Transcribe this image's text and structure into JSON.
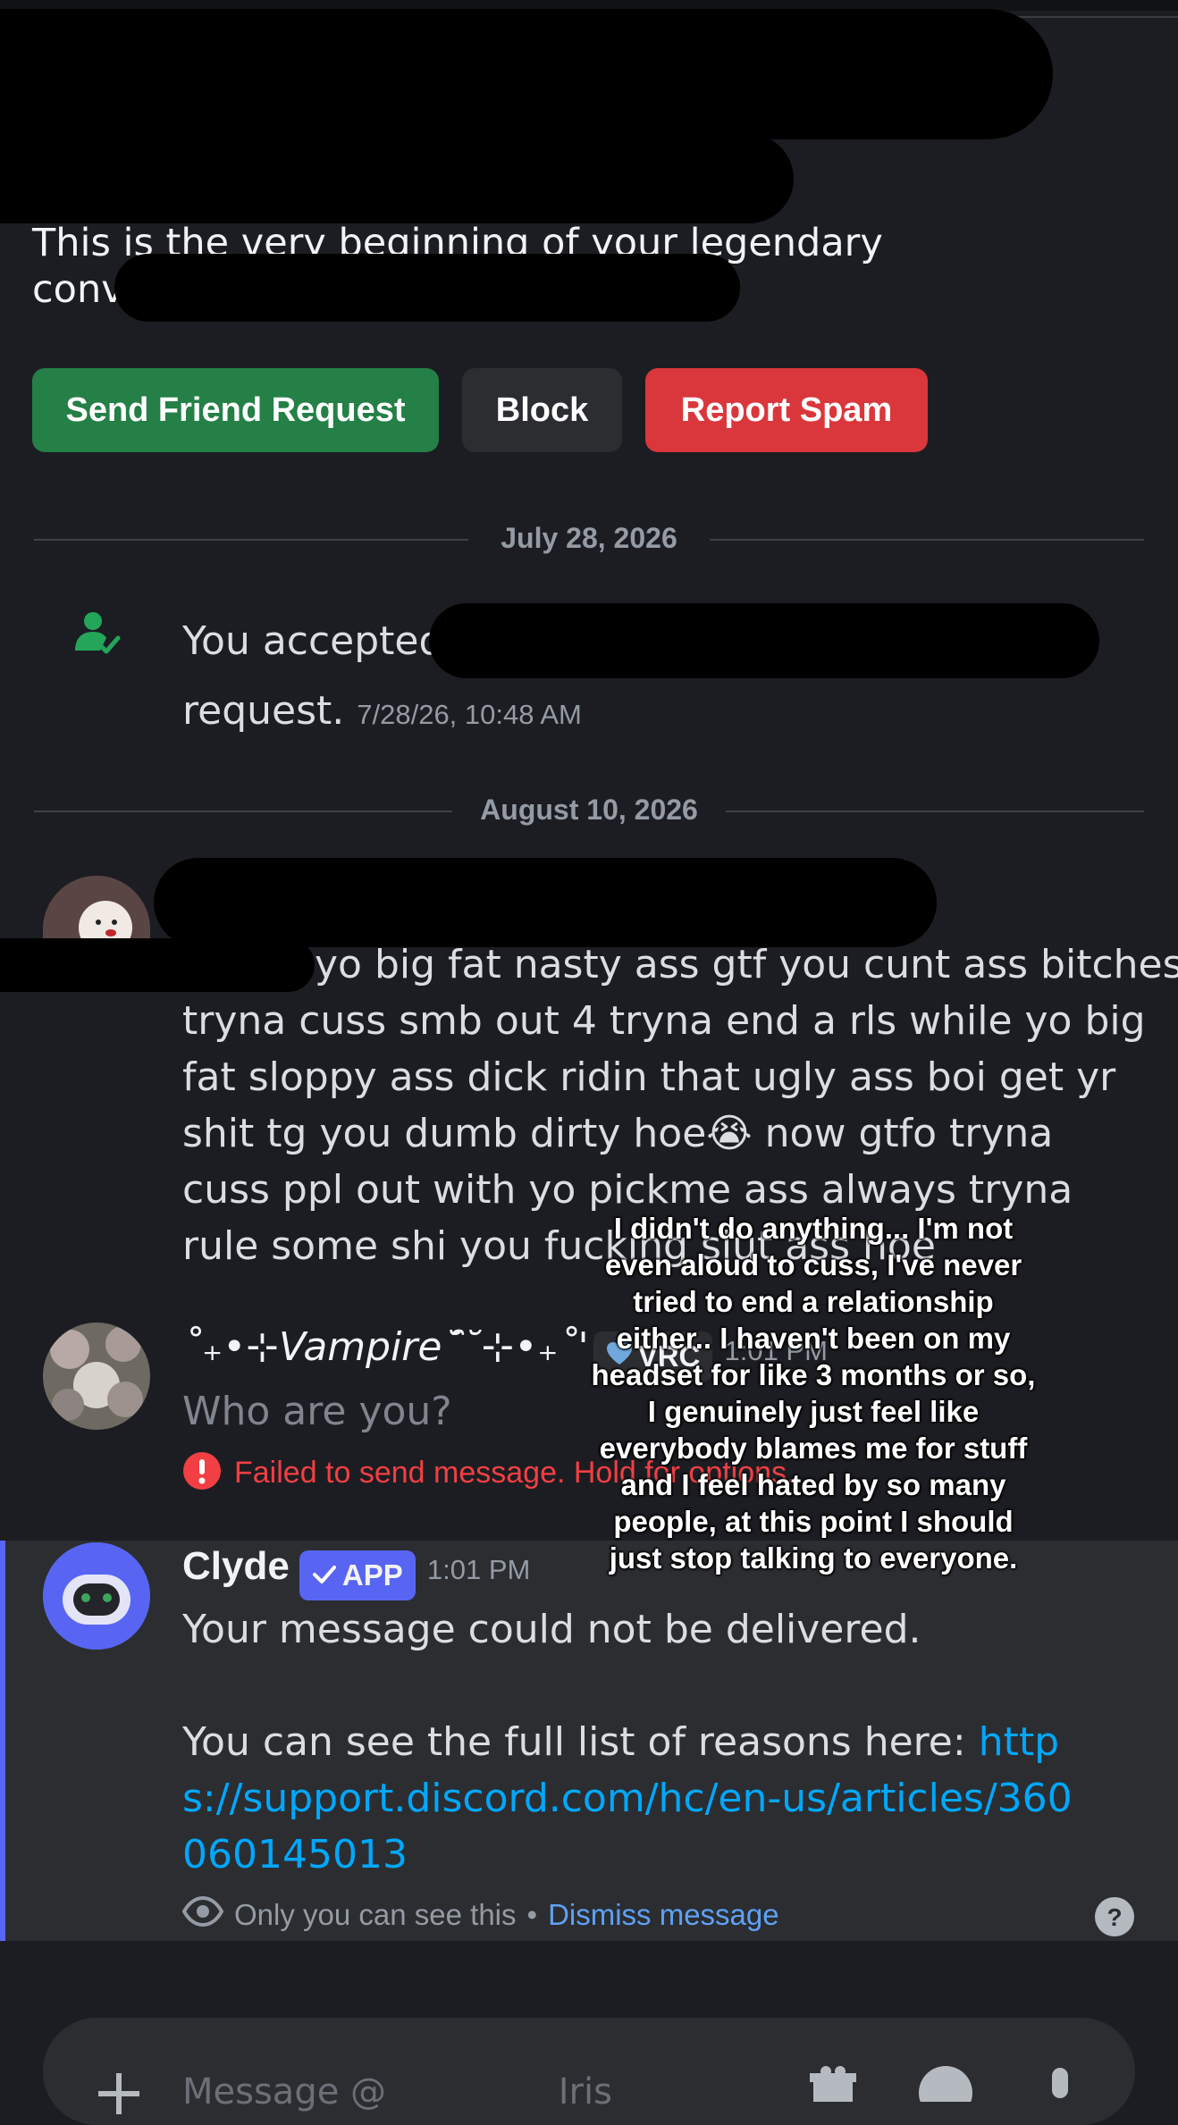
{
  "intro": {
    "text": "This is the very beginning of your legendary conversation with"
  },
  "actions": {
    "send_friend_request": "Send Friend Request",
    "block": "Block",
    "report_spam": "Report Spam"
  },
  "dividers": {
    "first": "July 28, 2026",
    "second": "August 10, 2026"
  },
  "system_message": {
    "prefix": "You accepted",
    "suffix": "request.",
    "timestamp": "7/28/26, 10:48 AM"
  },
  "received_message": {
    "text_line1": "yo big fat nasty ass gtf you cunt ass bitches u",
    "text_rest": "tryna cuss smb out 4 tryna end a rls while yo big fat sloppy ass dick ridin that ugly ass boi get yr shit tg you dumb dirty hoe",
    "emoji": "😭",
    "text_after_emoji": " now gtfo tryna cuss ppl out with yo pickme ass always tryna rule some shi you fucking slut ass hoe"
  },
  "own_message": {
    "username": "˚₊•⊹Vampire˘̑˘⊹•₊˚'",
    "tag_icon": "heart-icon",
    "tag": "VRC",
    "timestamp": "1:01 PM",
    "text": "Who are you?",
    "error": "Failed to send message. Hold for options."
  },
  "clyde_message": {
    "username": "Clyde",
    "badge": "APP",
    "timestamp": "1:01 PM",
    "line1": "Your message could not be delivered.",
    "line2_prefix": "You can see the full list of reasons here: ",
    "link": "https://support.discord.com/hc/en-us/articles/360060145013",
    "notice": "Only you can see this",
    "separator": "•",
    "dismiss": "Dismiss message"
  },
  "overlay_caption": "I didn't do anything... I'm not even aloud to cuss, I've never tried to end a relationship either.. I haven't been on my headset for like 3 months or so, I genuinely just feel like everybody blames me for stuff and I feel hated by so many people, at this point I should just stop talking to everyone.",
  "composer": {
    "placeholder": "Message @",
    "partial_name": "Iris"
  },
  "colors": {
    "background": "#1c1d22",
    "green": "#248046",
    "red": "#da373c",
    "blurple": "#5865f2",
    "link": "#00a8fc",
    "error": "#f23f43"
  }
}
